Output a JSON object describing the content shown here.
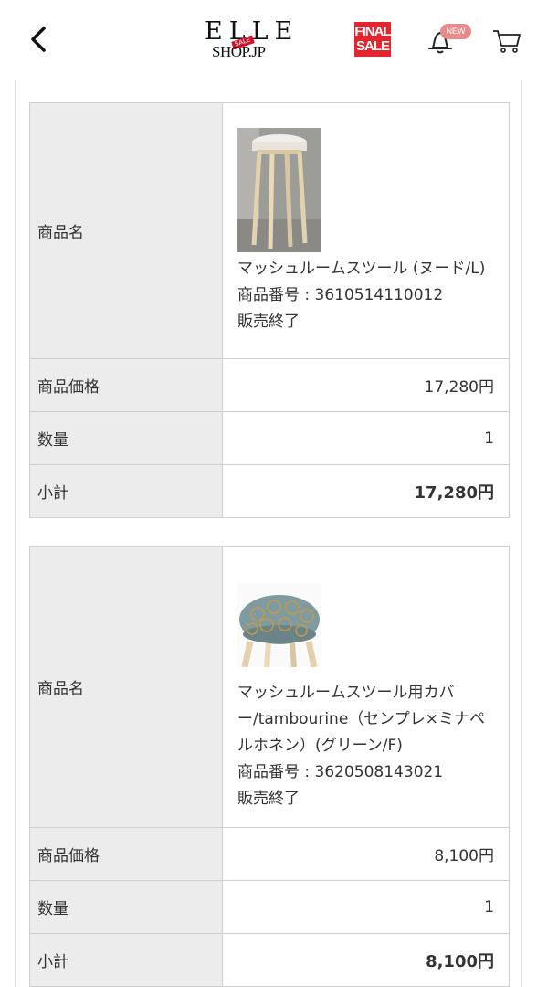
{
  "header": {
    "logo_text": "ELLE",
    "logo_sub": "SHOP.JP",
    "logo_sale": "SALE",
    "final_sale_line1": "FINAL",
    "final_sale_line2": "SALE",
    "new_badge": "NEW",
    "icons": {
      "back": "chevron-left-icon",
      "bell": "bell-icon",
      "cart": "cart-icon"
    }
  },
  "items": [
    {
      "name_label": "商品名",
      "product_name": "マッシュルームスツール (ヌード/L)",
      "product_code": "商品番号 : 3610514110012",
      "status": "販売終了",
      "price_label": "商品価格",
      "price": "17,280円",
      "qty_label": "数量",
      "qty": "1",
      "subtotal_label": "小計",
      "subtotal": "17,280円"
    },
    {
      "name_label": "商品名",
      "product_name": "マッシュルームスツール用カバー/tambourine（センプレ×ミナペルホネン）(グリーン/F)",
      "product_code": "商品番号 : 3620508143021",
      "status": "販売終了",
      "price_label": "商品価格",
      "price": "8,100円",
      "qty_label": "数量",
      "qty": "1",
      "subtotal_label": "小計",
      "subtotal": "8,100円"
    }
  ],
  "colors": {
    "final_sale": "#e5242d",
    "new_badge": "#e98a8a",
    "label_bg": "#ececec",
    "border": "#cfcfcf"
  }
}
